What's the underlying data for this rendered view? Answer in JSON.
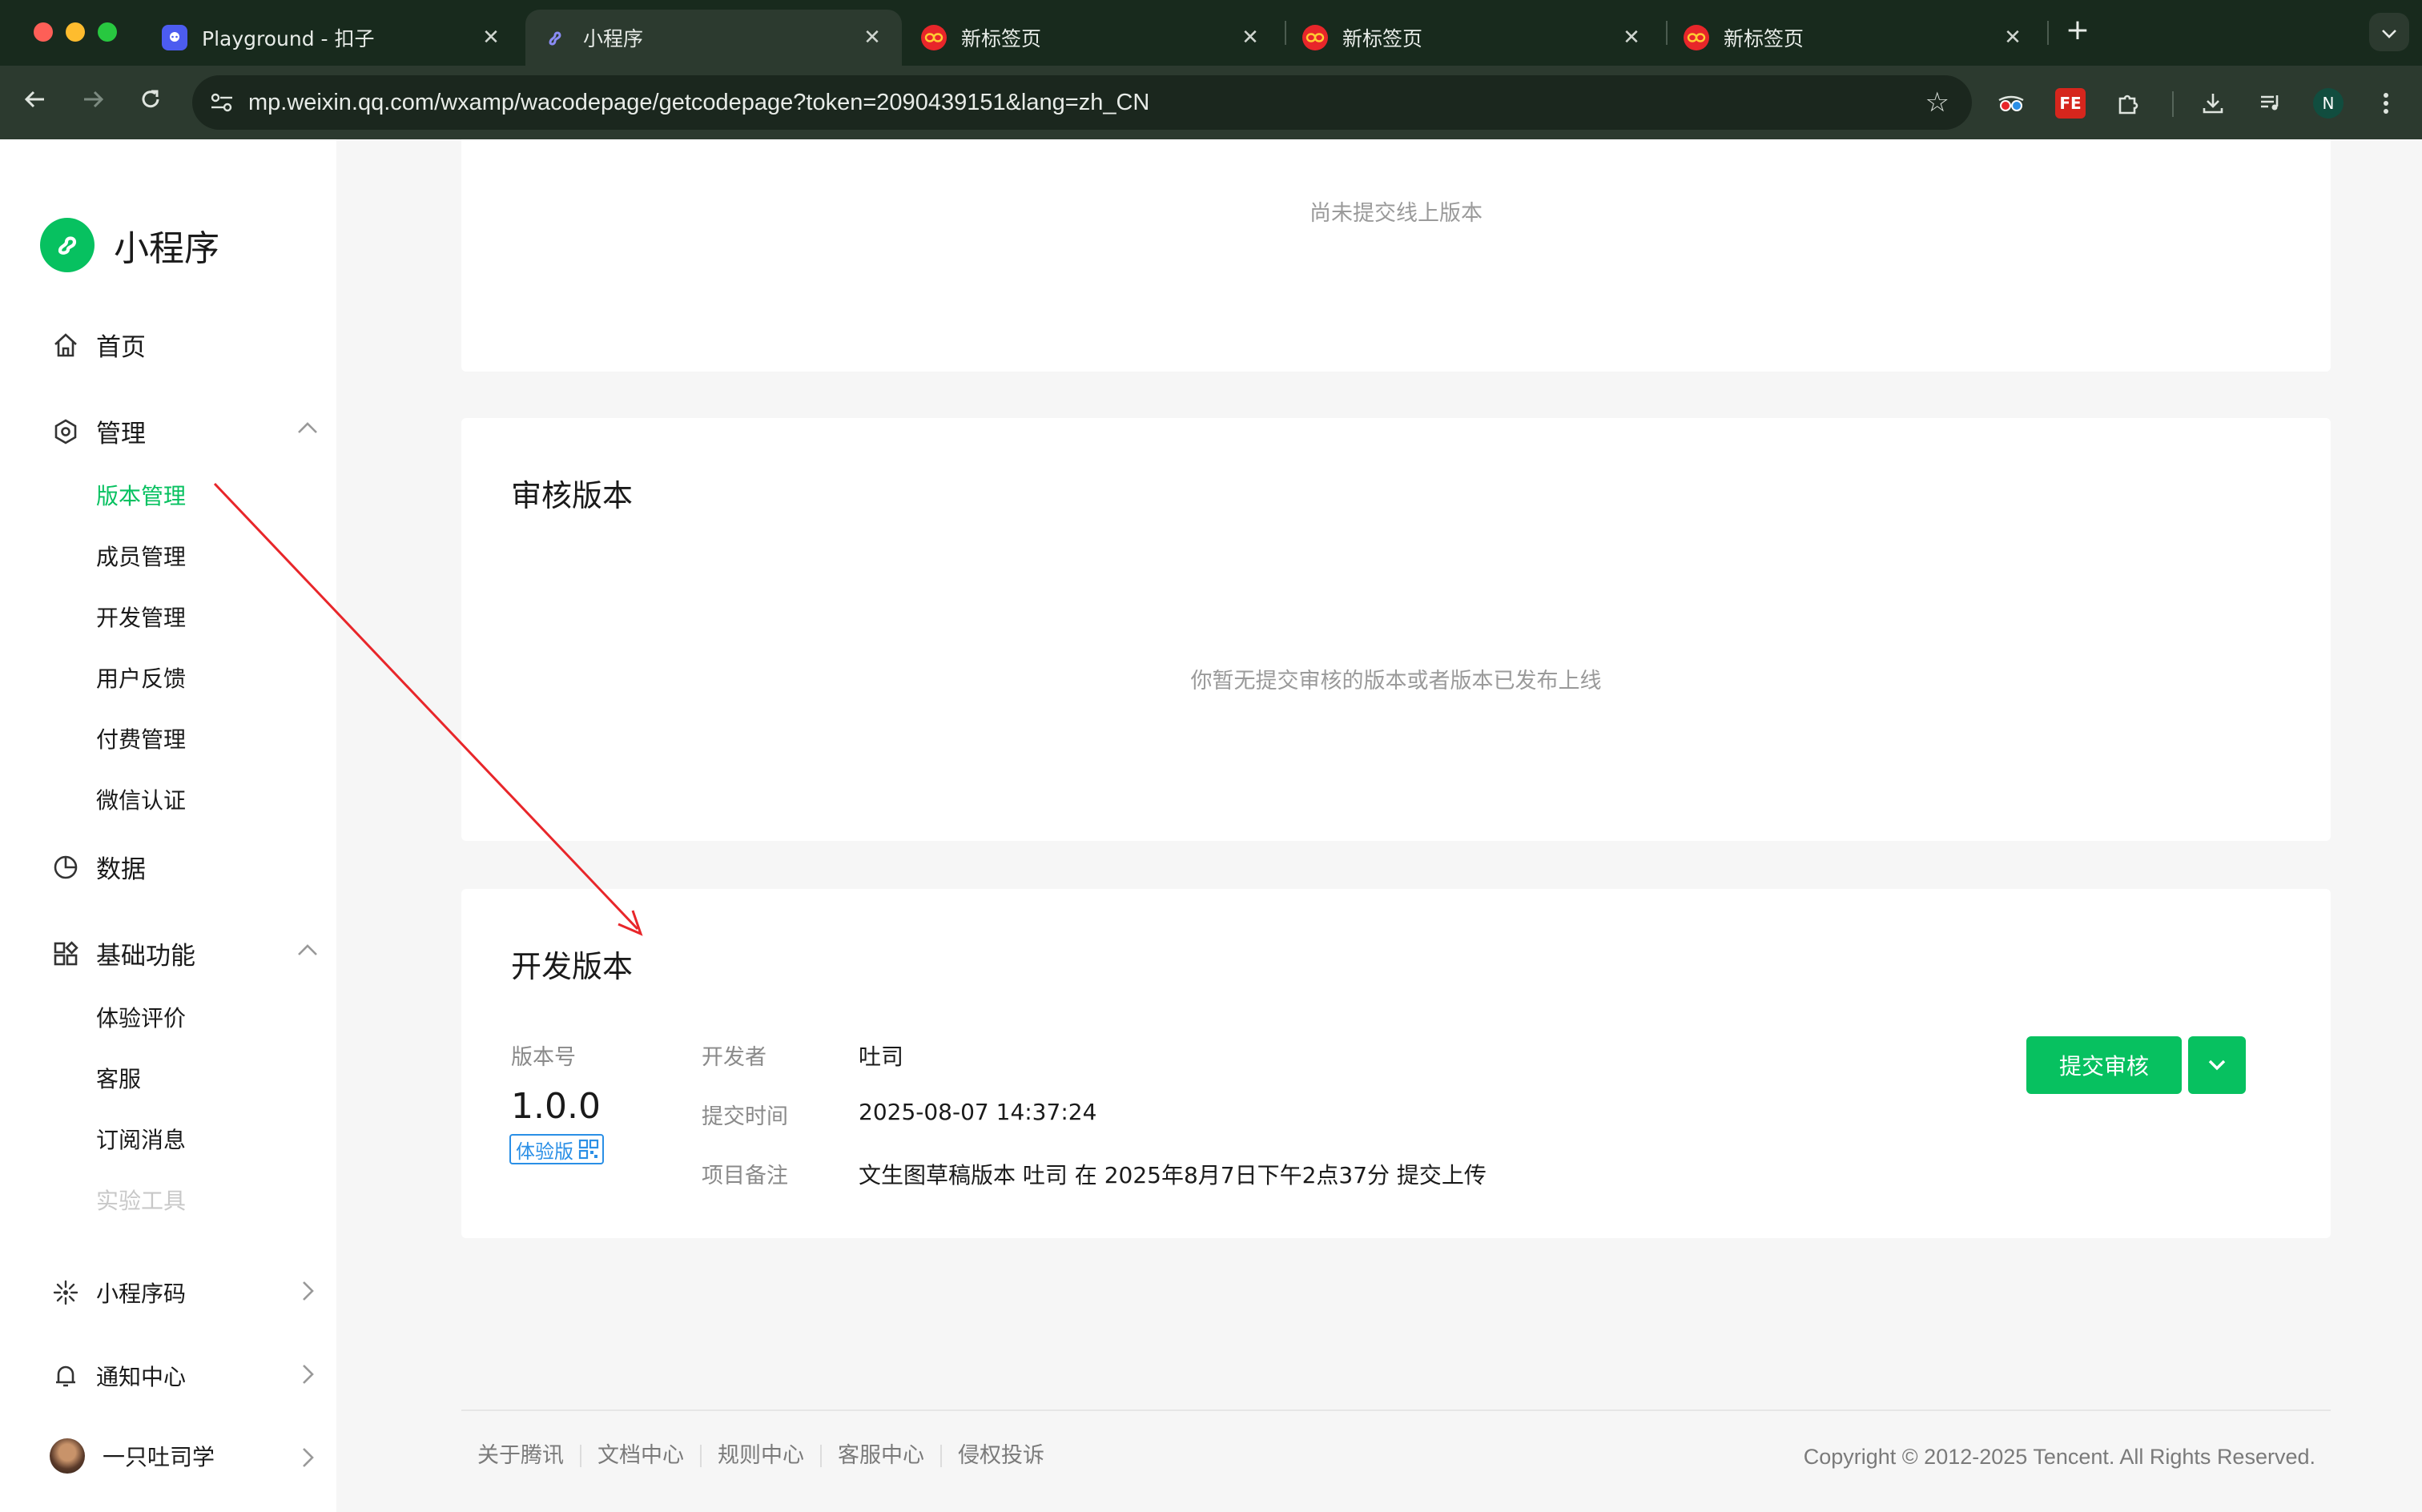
{
  "browser": {
    "tabs": [
      {
        "title": "Playground - 扣子",
        "favicon": "coze-icon",
        "active": false
      },
      {
        "title": "小程序",
        "favicon": "miniprogram-icon",
        "active": true
      },
      {
        "title": "新标签页",
        "favicon": "newtab-icon",
        "active": false
      },
      {
        "title": "新标签页",
        "favicon": "newtab-icon",
        "active": false
      },
      {
        "title": "新标签页",
        "favicon": "newtab-icon",
        "active": false
      }
    ],
    "new_tab": "+",
    "url": "mp.weixin.qq.com/wxamp/wacodepage/getcodepage?token=2090439151&lang=zh_CN",
    "profile_initial": "N",
    "fe_ext_label": "FE"
  },
  "sidebar": {
    "logo_text": "小程序",
    "home": "首页",
    "manage": {
      "label": "管理",
      "items": [
        "版本管理",
        "成员管理",
        "开发管理",
        "用户反馈",
        "付费管理",
        "微信认证"
      ]
    },
    "data": "数据",
    "basic": {
      "label": "基础功能",
      "items": [
        "体验评价",
        "客服",
        "订阅消息",
        "实验工具"
      ]
    },
    "qrcode": "小程序码",
    "notify": "通知中心",
    "user": "一只吐司学"
  },
  "main": {
    "online": {
      "empty": "尚未提交线上版本"
    },
    "review": {
      "title": "审核版本",
      "empty": "你暂无提交审核的版本或者版本已发布上线"
    },
    "dev": {
      "title": "开发版本",
      "version_label": "版本号",
      "version": "1.0.0",
      "badge": "体验版",
      "developer_label": "开发者",
      "developer": "吐司",
      "time_label": "提交时间",
      "time": "2025-08-07 14:37:24",
      "note_label": "项目备注",
      "note": "文生图草稿版本 吐司 在 2025年8月7日下午2点37分 提交上传",
      "submit": "提交审核"
    }
  },
  "footer": {
    "links": [
      "关于腾讯",
      "文档中心",
      "规则中心",
      "客服中心",
      "侵权投诉"
    ],
    "copyright": "Copyright © 2012-2025 Tencent. All Rights Reserved."
  },
  "colors": {
    "brand": "#07c160",
    "link_badge": "#2a8fe6",
    "annotation": "#e8262a"
  }
}
